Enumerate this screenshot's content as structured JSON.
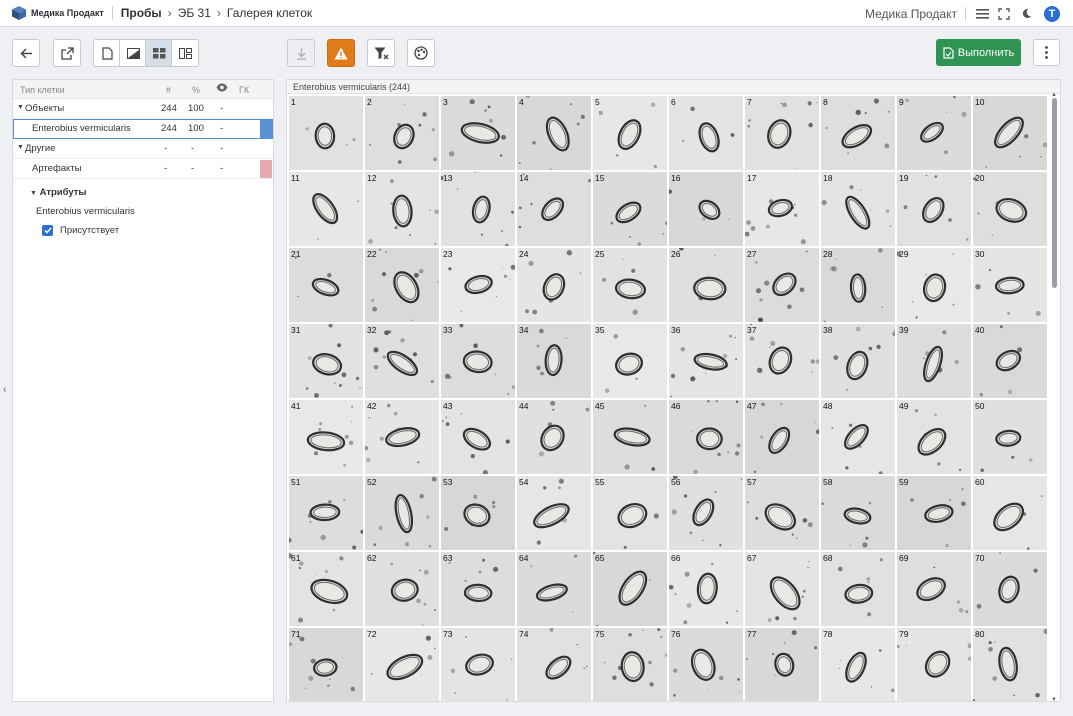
{
  "app": {
    "logo_text": "Медика Продакт",
    "breadcrumb": [
      "Пробы",
      "ЭБ 31",
      "Галерея клеток"
    ],
    "company": "Медика Продакт",
    "user_initial": "T"
  },
  "toolbar": {
    "run_label": "Выполнить",
    "warning_color": "#e07b1a",
    "run_color": "#2e9353"
  },
  "cell_types": {
    "headers": {
      "type": "Тип клетки",
      "count": "#",
      "percent": "%",
      "gk": "ГК"
    },
    "rows": [
      {
        "label": "Объекты",
        "count": "244",
        "percent": "100",
        "visible": "-",
        "group": true
      },
      {
        "label": "Enterobius vermicularis",
        "count": "244",
        "percent": "100",
        "visible": "-",
        "selected": true,
        "color": "#5b8fd6"
      },
      {
        "label": "Другие",
        "count": "-",
        "percent": "-",
        "visible": "-",
        "group": true
      },
      {
        "label": "Артефакты",
        "count": "-",
        "percent": "-",
        "visible": "-",
        "color": "#e6a8ad"
      }
    ]
  },
  "attributes": {
    "title": "Атрибуты",
    "subject": "Enterobius vermicularis",
    "checkbox_label": "Присутствует",
    "checked": true
  },
  "gallery": {
    "title": "Enterobius vermicularis (244)",
    "cells": [
      "1",
      "2",
      "3",
      "4",
      "5",
      "6",
      "7",
      "8",
      "9",
      "10",
      "11",
      "12",
      "13",
      "14",
      "15",
      "16",
      "17",
      "18",
      "19",
      "20",
      "21",
      "22",
      "23",
      "24",
      "25",
      "26",
      "27",
      "28",
      "29",
      "30",
      "31",
      "32",
      "33",
      "34",
      "35",
      "36",
      "37",
      "38",
      "39",
      "40",
      "41",
      "42",
      "43",
      "44",
      "45",
      "46",
      "47",
      "48",
      "49",
      "50",
      "51",
      "52",
      "53",
      "54",
      "55",
      "56",
      "57",
      "58",
      "59",
      "60",
      "61",
      "62",
      "63",
      "64",
      "65",
      "66",
      "67",
      "68",
      "69",
      "70",
      "71",
      "72",
      "73",
      "74",
      "75",
      "76",
      "77",
      "78",
      "79",
      "80"
    ]
  }
}
